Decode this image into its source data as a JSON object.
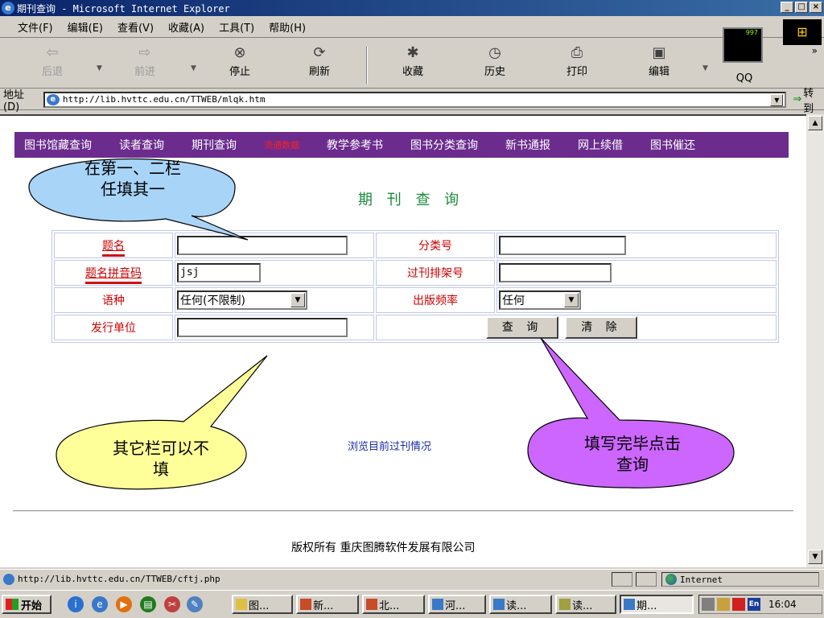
{
  "window": {
    "title": "期刊查询 - Microsoft Internet Explorer",
    "buttons": [
      "_",
      "□",
      "×"
    ]
  },
  "menu": [
    "文件(F)",
    "编辑(E)",
    "查看(V)",
    "收藏(A)",
    "工具(T)",
    "帮助(H)"
  ],
  "throbber": {
    "value": "997"
  },
  "toolbar": {
    "back": "后退",
    "forward": "前进",
    "stop": "停止",
    "refresh": "刷新",
    "favorites": "收藏",
    "history": "历史",
    "print": "打印",
    "edit": "编辑",
    "qq": "QQ"
  },
  "address": {
    "label": "地址(D)",
    "url": "http://lib.hvttc.edu.cn/TTWEB/mlqk.htm",
    "go": "转到"
  },
  "nav": [
    "图书馆藏查询",
    "读者查询",
    "期刊查询",
    "流通数据",
    "教学参考书",
    "图书分类查询",
    "新书通报",
    "网上续借",
    "图书催还"
  ],
  "page_title": "期 刊 查 询",
  "form": {
    "title_label": "题名",
    "title_value": "",
    "class_label": "分类号",
    "class_value": "",
    "pinyin_label": "题名拼音码",
    "pinyin_value": "jsj",
    "shelf_label": "过刊排架号",
    "shelf_value": "",
    "lang_label": "语种",
    "lang_value": "任何(不限制)",
    "freq_label": "出版频率",
    "freq_value": "任何",
    "publisher_label": "发行单位",
    "publisher_value": "",
    "query_button": "查 询",
    "clear_button": "清 除"
  },
  "browse_link": "浏览目前过刊情况",
  "copyright": "版权所有 重庆图腾软件发展有限公司",
  "callouts": {
    "top_left": [
      "在第一、二栏",
      "任填其一"
    ],
    "bottom_left": [
      "其它栏可以不",
      "填"
    ],
    "right": [
      "填写完毕点击",
      "查询"
    ]
  },
  "colors": {
    "nav_bg": "#6b2c8e",
    "callout_blue": "#a8d4f8",
    "callout_yellow": "#ffff99",
    "callout_purple": "#cc66ff",
    "title_green": "#1a8c3a"
  },
  "status": {
    "url": "http://lib.hvttc.edu.cn/TTWEB/cftj.php",
    "zone": "Internet"
  },
  "taskbar": {
    "start": "开始",
    "tasks": [
      "图...",
      "新...",
      "北...",
      "河...",
      "读...",
      "读...",
      "期..."
    ],
    "lang": "En",
    "clock": "16:04"
  }
}
